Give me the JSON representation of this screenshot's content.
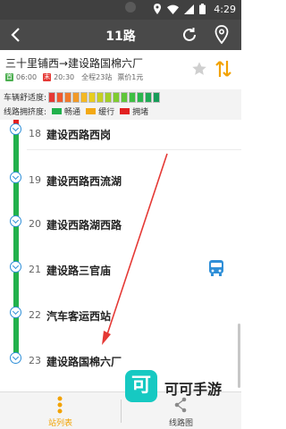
{
  "status_bar": {
    "time": "4:29",
    "icons": [
      "location-icon",
      "wifi-icon",
      "signal-icon",
      "battery-icon"
    ]
  },
  "app_bar": {
    "title": "11路",
    "back_icon": "back-arrow-icon",
    "refresh_icon": "refresh-icon",
    "map_icon": "map-pin-icon"
  },
  "route": {
    "name": "三十里铺西→建设路国棉六厂",
    "first_badge": "首",
    "first_time": "06:00",
    "last_badge": "末",
    "last_time": "20:30",
    "length": "全程23站",
    "fare": "票价1元"
  },
  "legend": {
    "comfort_label": "车辆舒适度:",
    "comfort_colors": [
      "#e53935",
      "#ef5a2f",
      "#f07a2b",
      "#f29a27",
      "#f4b824",
      "#e7cd20",
      "#c6cf22",
      "#a3cf28",
      "#7fcc30",
      "#5fc53a",
      "#3fbf44",
      "#2bb64e",
      "#1faa55",
      "#179c58"
    ],
    "congestion_label": "线路拥挤度:",
    "levels": [
      {
        "label": "畅通",
        "color": "#22b14c"
      },
      {
        "label": "缓行",
        "color": "#f3a915"
      },
      {
        "label": "拥堵",
        "color": "#e22020"
      }
    ]
  },
  "line_colors": {
    "top": "#e22020",
    "main": "#22b14c"
  },
  "stops": [
    {
      "num": "18",
      "name": "建设西路西岗"
    },
    {
      "num": "19",
      "name": "建设西路西流湖"
    },
    {
      "num": "20",
      "name": "建设西路湖西路"
    },
    {
      "num": "21",
      "name": "建设路三官庙"
    },
    {
      "num": "22",
      "name": "汽车客运西站"
    },
    {
      "num": "23",
      "name": "建设路国棉六厂"
    }
  ],
  "tabs": [
    {
      "label": "站列表",
      "icon": "list-dots-icon",
      "active": true
    },
    {
      "label": "线路图",
      "icon": "share-nodes-icon",
      "active": false
    }
  ],
  "watermark": {
    "logo_char": "可",
    "text": "可可手游"
  }
}
